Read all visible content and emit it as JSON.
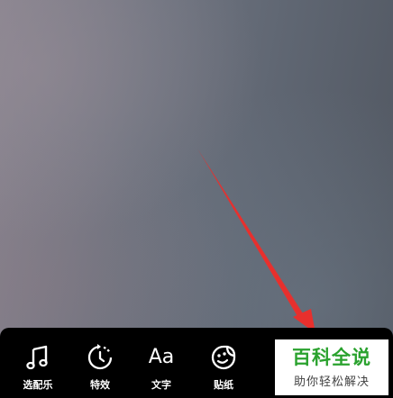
{
  "toolbar": {
    "items": [
      {
        "label": "选配乐",
        "icon": "music-note-icon"
      },
      {
        "label": "特效",
        "icon": "effects-timer-icon"
      },
      {
        "label": "文字",
        "icon": "text-aa-icon",
        "glyph": "Aa"
      },
      {
        "label": "贴纸",
        "icon": "sticker-icon"
      }
    ]
  },
  "watermark": {
    "title": "百科全说",
    "subtitle": "助你轻松解决",
    "title_color": "#2aa22e"
  },
  "annotation": {
    "arrow_color": "#e8302d"
  }
}
